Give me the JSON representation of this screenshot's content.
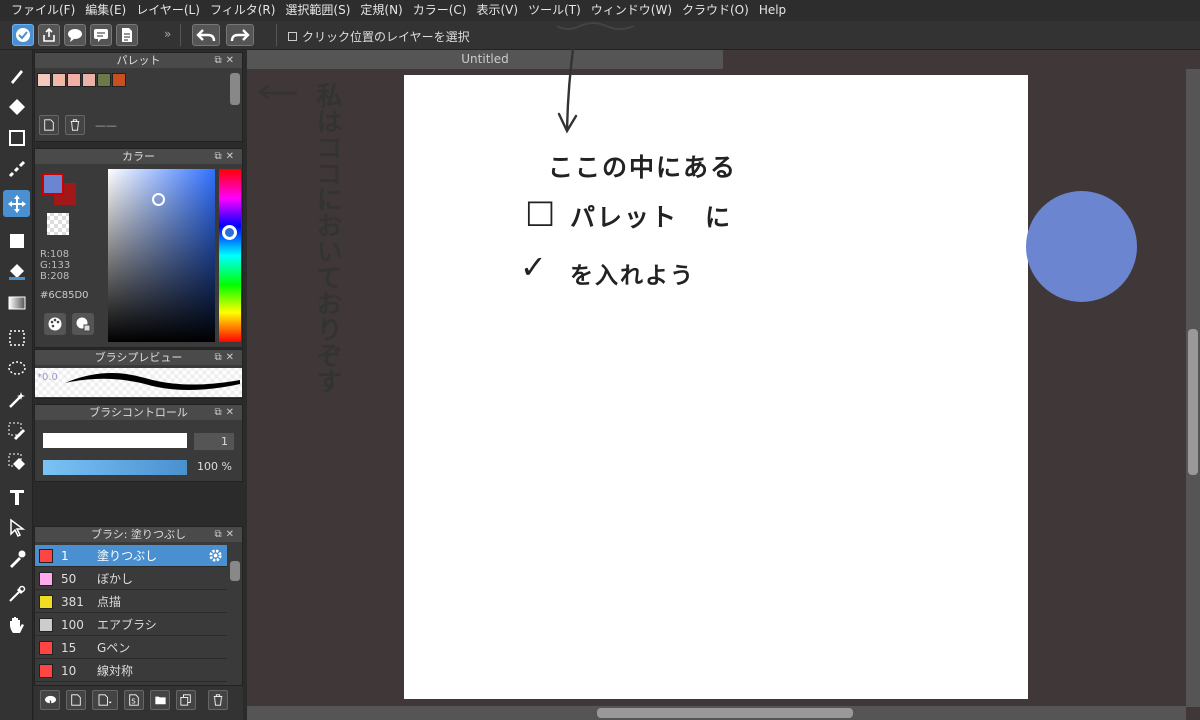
{
  "menu": [
    "ファイル(F)",
    "編集(E)",
    "レイヤー(L)",
    "フィルタ(R)",
    "選択範囲(S)",
    "定規(N)",
    "カラー(C)",
    "表示(V)",
    "ツール(T)",
    "ウィンドウ(W)",
    "クラウド(O)",
    "Help"
  ],
  "toolbar": {
    "checkbox_label": "クリック位置のレイヤーを選択",
    "expand_glyph": "»"
  },
  "palette": {
    "title": "パレット",
    "swatches": [
      "#f4c9bd",
      "#f2b8a8",
      "#f0b0a8",
      "#ebb0a8",
      "#6a7a4a",
      "#c85020"
    ],
    "dash": "——"
  },
  "color": {
    "title": "カラー",
    "fg": "#6c85d0",
    "bg": "#a01818",
    "r_label": "R:108",
    "g_label": "G:133",
    "b_label": "B:208",
    "hex": "#6C85D0"
  },
  "brush_preview": {
    "title": "ブラシプレビュー",
    "size_label": "*0.0"
  },
  "brush_control": {
    "title": "ブラシコントロール",
    "size_value": "1",
    "opacity_value": "100 %"
  },
  "brush_list": {
    "title": "ブラシ: 塗りつぶし",
    "rows": [
      {
        "num": "1",
        "name": "塗りつぶし",
        "chip": "#ff4444",
        "selected": true
      },
      {
        "num": "50",
        "name": "ぼかし",
        "chip": "#ffaaee",
        "selected": false
      },
      {
        "num": "381",
        "name": "点描",
        "chip": "#eedd22",
        "selected": false
      },
      {
        "num": "100",
        "name": "エアブラシ",
        "chip": "#cccccc",
        "selected": false
      },
      {
        "num": "15",
        "name": "Gペン",
        "chip": "#ff4444",
        "selected": false
      },
      {
        "num": "10",
        "name": "線対称",
        "chip": "#ff4444",
        "selected": false
      }
    ]
  },
  "canvas": {
    "tab_title": "Untitled",
    "circle_color": "#6c85d0"
  },
  "annotations": {
    "side_note": "私はココにおいておりぞす",
    "line1": "ここの中にある",
    "line2_box": "□",
    "line2_text": "パレット　に",
    "line3_check": "✓",
    "line3_text": "を入れよう"
  },
  "accent": "#4a90d0"
}
